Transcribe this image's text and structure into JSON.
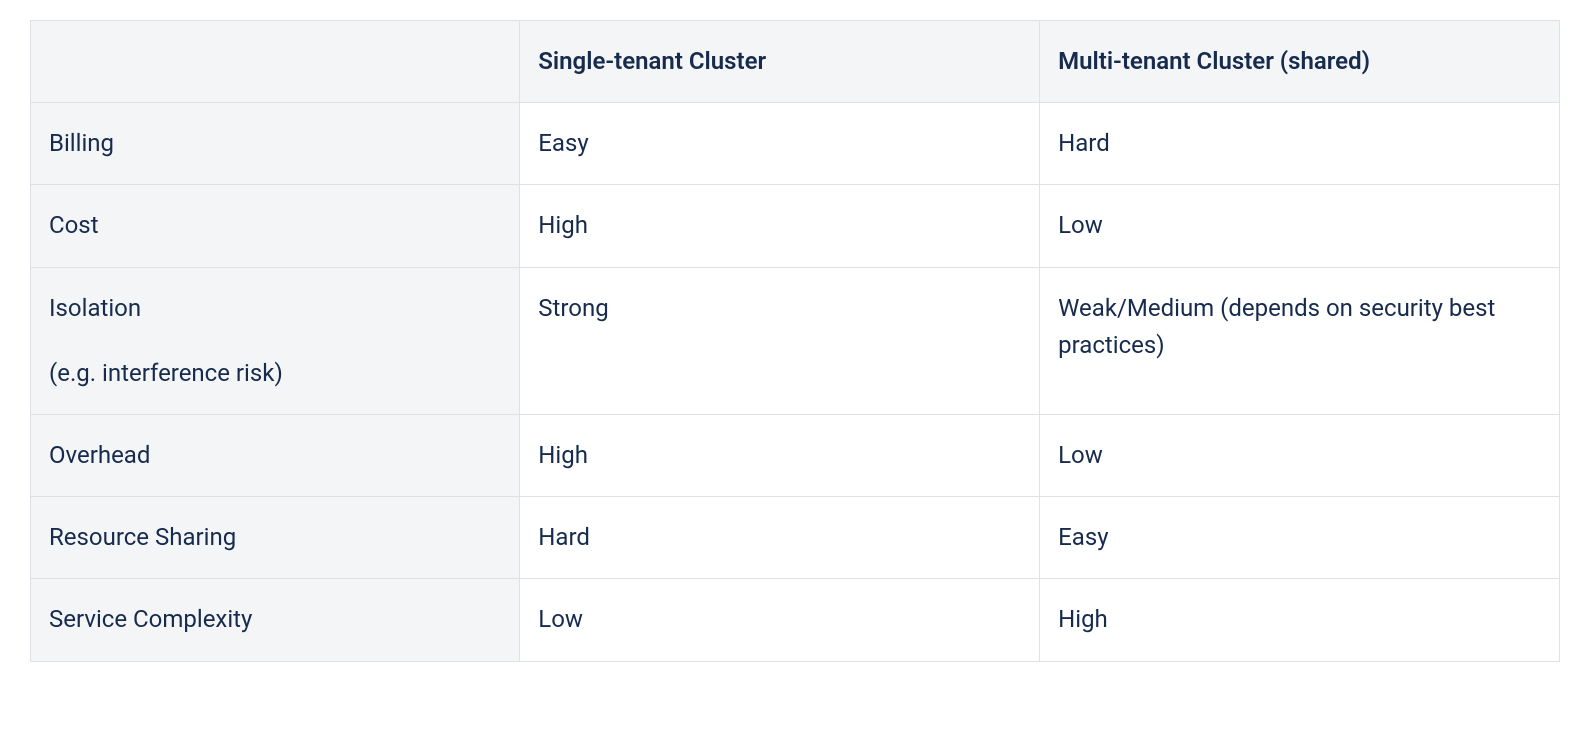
{
  "chart_data": {
    "type": "table",
    "headers": [
      "",
      "Single-tenant Cluster",
      "Multi-tenant Cluster (shared)"
    ],
    "rows": [
      {
        "label": "Billing",
        "sublabel": "",
        "single": "Easy",
        "multi": "Hard"
      },
      {
        "label": "Cost",
        "sublabel": "",
        "single": "High",
        "multi": "Low"
      },
      {
        "label": "Isolation",
        "sublabel": "(e.g. interference risk)",
        "single": "Strong",
        "multi": "Weak/Medium (depends on security best practices)"
      },
      {
        "label": "Overhead",
        "sublabel": "",
        "single": "High",
        "multi": "Low"
      },
      {
        "label": "Resource Sharing",
        "sublabel": "",
        "single": "Hard",
        "multi": "Easy"
      },
      {
        "label": "Service Complexity",
        "sublabel": "",
        "single": "Low",
        "multi": "High"
      }
    ]
  }
}
